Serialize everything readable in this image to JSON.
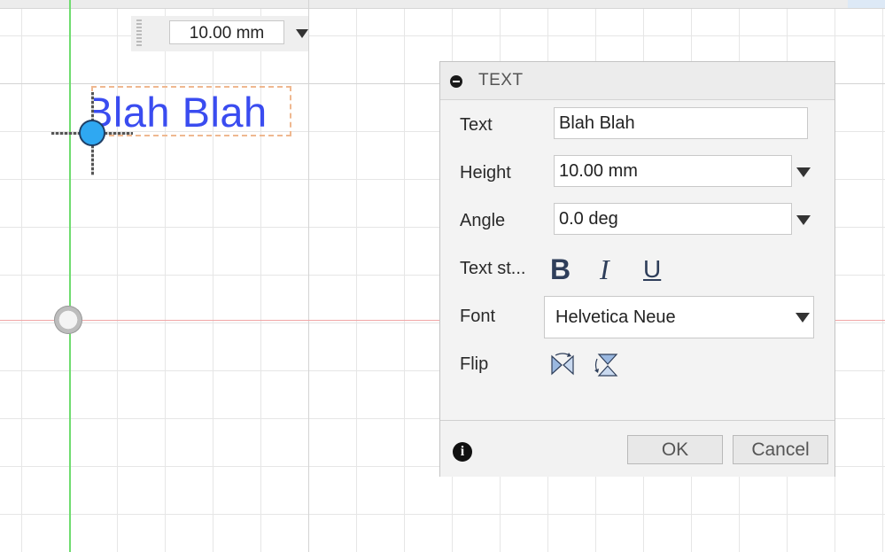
{
  "dimension_input": {
    "value": "10.00 mm"
  },
  "sketch": {
    "text": "Blah Blah"
  },
  "dialog": {
    "title": "TEXT",
    "text_label": "Text",
    "text_value": "Blah Blah",
    "height_label": "Height",
    "height_value": "10.00 mm",
    "angle_label": "Angle",
    "angle_value": "0.0 deg",
    "style_label": "Text st...",
    "style_buttons": {
      "bold": "B",
      "italic": "I",
      "underline": "U"
    },
    "font_label": "Font",
    "font_value": "Helvetica Neue",
    "flip_label": "Flip",
    "flip_icons": [
      "flip-horizontal-icon",
      "flip-vertical-icon"
    ],
    "ok_label": "OK",
    "cancel_label": "Cancel"
  },
  "colors": {
    "sketch_text": "#3a4cf0",
    "anchor_point": "#2fa8f2",
    "selection_box": "#efb890",
    "axis_green": "#6fdc6f",
    "axis_red": "#f0a6a6"
  }
}
